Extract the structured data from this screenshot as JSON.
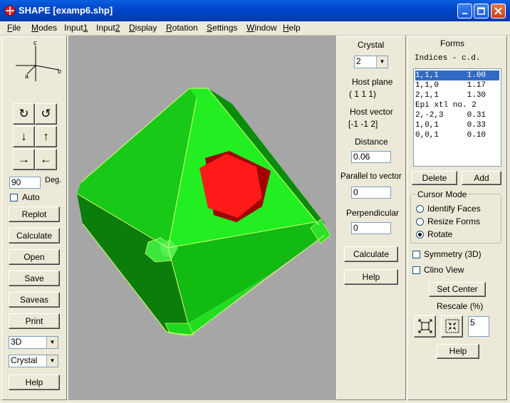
{
  "window": {
    "title": "SHAPE [examp6.shp]"
  },
  "menu": [
    "File",
    "Modes",
    "Input1",
    "Input2",
    "Display",
    "Rotation",
    "Settings",
    "Window",
    "Help"
  ],
  "menu_accel": [
    "F",
    "M",
    "1",
    "2",
    "D",
    "R",
    "S",
    "W",
    "H"
  ],
  "left": {
    "axes": {
      "c": "c",
      "a": "a",
      "b": "b"
    },
    "rotate_buttons": [
      "↻",
      "↺",
      "↓",
      "↑",
      "→",
      "←"
    ],
    "degrees_value": "90",
    "degrees_label": "Deg.",
    "auto_label": "Auto",
    "replot": "Replot",
    "calculate": "Calculate",
    "open": "Open",
    "save": "Save",
    "saveas": "Saveas",
    "print": "Print",
    "mode_select": "3D",
    "view_select": "Crystal",
    "help": "Help"
  },
  "middle": {
    "crystal_label": "Crystal",
    "crystal_value": "2",
    "host_plane_label": "Host plane",
    "host_plane_value": "( 1  1  1)",
    "host_vector_label": "Host vector",
    "host_vector_value": "[-1  -1  2]",
    "distance_label": "Distance",
    "distance_value": "0.06",
    "parallel_label": "Parallel to vector",
    "parallel_value": "0",
    "perpendicular_label": "Perpendicular",
    "perpendicular_value": "0",
    "calculate": "Calculate",
    "help": "Help"
  },
  "right": {
    "forms_label": "Forms",
    "indices_header": "Indices - c.d.",
    "forms": [
      {
        "text": "1,1,1      1.00",
        "selected": true
      },
      {
        "text": "1,1,0      1.17",
        "selected": false
      },
      {
        "text": "2,1,1      1.30",
        "selected": false
      },
      {
        "text": "Epi xtl no. 2",
        "selected": false
      },
      {
        "text": "2,-2,3     0.31",
        "selected": false
      },
      {
        "text": "1,0,1      0.33",
        "selected": false
      },
      {
        "text": "0,0,1      0.10",
        "selected": false
      }
    ],
    "delete": "Delete",
    "add": "Add",
    "cursor_mode_label": "Cursor Mode",
    "cursor_modes": [
      "Identify Faces",
      "Resize Forms",
      "Rotate"
    ],
    "cursor_selected": 2,
    "symmetry_label": "Symmetry (3D)",
    "clino_label": "Clino View",
    "set_center": "Set Center",
    "rescale_label": "Rescale (%)",
    "rescale_value": "5",
    "help": "Help"
  },
  "colors": {
    "crystal_light": "#22ee22",
    "crystal_mid": "#11bb11",
    "crystal_dark": "#0a7d0a",
    "epitaxial": "#ff1a1a",
    "viewport_bg": "#a6a6a6"
  }
}
